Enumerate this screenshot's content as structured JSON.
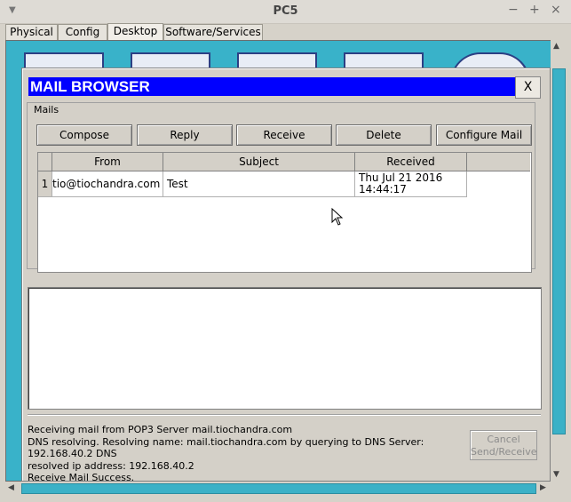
{
  "window": {
    "title": "PC5",
    "controls": {
      "minimize": "−",
      "maximize": "+",
      "close": "×"
    },
    "menu_icon": "triangle-down-icon"
  },
  "tabs": [
    {
      "label": "Physical",
      "active": false
    },
    {
      "label": "Config",
      "active": false
    },
    {
      "label": "Desktop",
      "active": true
    },
    {
      "label": "Software/Services",
      "active": false
    }
  ],
  "dialog": {
    "title": "MAIL BROWSER",
    "close_label": "X",
    "mails_group_label": "Mails",
    "buttons": {
      "compose": "Compose",
      "reply": "Reply",
      "receive": "Receive",
      "delete": "Delete",
      "configure": "Configure Mail"
    },
    "table": {
      "columns": [
        "From",
        "Subject",
        "Received"
      ],
      "rows": [
        {
          "index": "1",
          "from": "tio@tiochandra.com",
          "subject": "Test",
          "received_line1": "Thu Jul 21 2016",
          "received_line2": "14:44:17"
        }
      ]
    },
    "status_lines": [
      "Receiving mail from POP3 Server mail.tiochandra.com",
      "DNS resolving. Resolving name: mail.tiochandra.com by querying to DNS Server: 192.168.40.2  DNS",
      "resolved ip address: 192.168.40.2",
      "Receive Mail Success."
    ],
    "cancel_button": {
      "line1": "Cancel",
      "line2": "Send/Receive",
      "enabled": false
    }
  },
  "colors": {
    "desktop_bg": "#39b2c9",
    "dialog_title_bg": "#0000ff"
  }
}
